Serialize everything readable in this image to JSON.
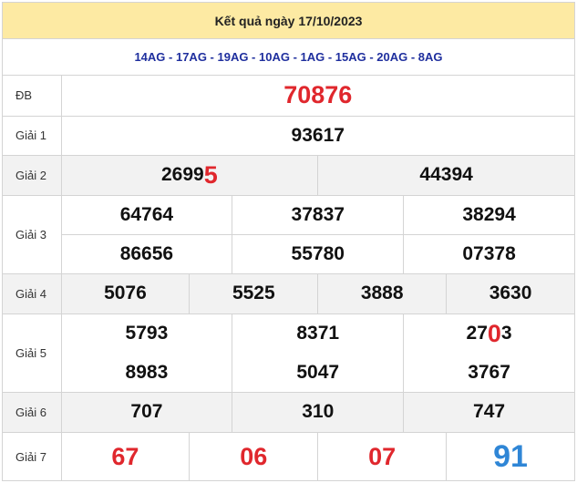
{
  "title": "Kết quả ngày 17/10/2023",
  "codes": "14AG - 17AG - 19AG - 10AG - 1AG - 15AG - 20AG - 8AG",
  "prizes": {
    "db": {
      "label": "ĐB",
      "value": "70876"
    },
    "g1": {
      "label": "Giải 1",
      "value": "93617"
    },
    "g2": {
      "label": "Giải 2",
      "values": [
        {
          "main": "2699",
          "hl": "5"
        },
        {
          "main": "44394"
        }
      ]
    },
    "g3": {
      "label": "Giải 3",
      "values": [
        "64764",
        "37837",
        "38294",
        "86656",
        "55780",
        "07378"
      ]
    },
    "g4": {
      "label": "Giải 4",
      "values": [
        "5076",
        "5525",
        "3888",
        "3630"
      ]
    },
    "g5": {
      "label": "Giải 5",
      "values": [
        {
          "main": "5793"
        },
        {
          "main": "8371"
        },
        {
          "pre": "27",
          "hl": "0",
          "post": "3"
        },
        {
          "main": "8983"
        },
        {
          "main": "5047"
        },
        {
          "main": "3767"
        }
      ]
    },
    "g6": {
      "label": "Giải 6",
      "values": [
        "707",
        "310",
        "747"
      ]
    },
    "g7": {
      "label": "Giải 7",
      "values": [
        "67",
        "06",
        "07",
        "91"
      ]
    }
  },
  "colors": {
    "header_bg": "#fdeaa3",
    "codes_text": "#1f2f9e",
    "highlight_red": "#e0272d",
    "highlight_blue": "#2f86d6"
  }
}
